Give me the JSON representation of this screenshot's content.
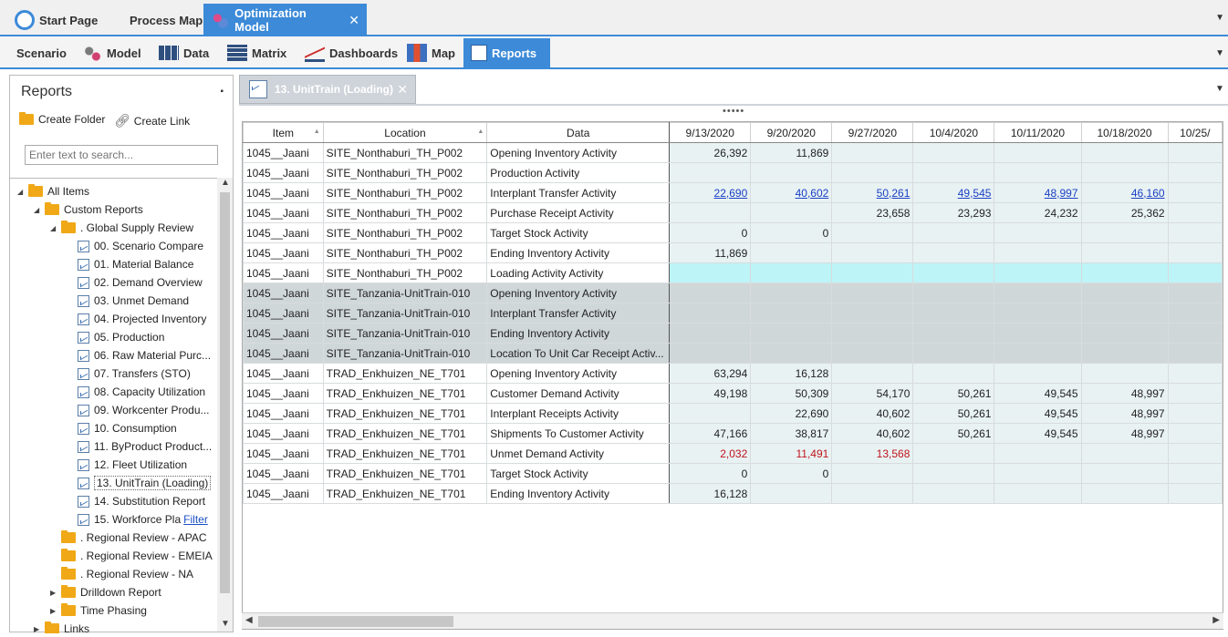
{
  "top_tabs": [
    {
      "label": "Start Page",
      "icon": "start-page-icon"
    },
    {
      "label": "Process Map",
      "icon": "none"
    },
    {
      "label": "Optimization Model",
      "icon": "optimization-model-icon",
      "active": true
    }
  ],
  "ribbon_tabs": [
    {
      "label": "Scenario",
      "icon": "none"
    },
    {
      "label": "Model",
      "icon": "gears-icon"
    },
    {
      "label": "Data",
      "icon": "table-icon"
    },
    {
      "label": "Matrix",
      "icon": "matrix-icon"
    },
    {
      "label": "Dashboards",
      "icon": "dashboard-chart-icon"
    },
    {
      "label": "Map",
      "icon": "map-icon"
    },
    {
      "label": "Reports",
      "icon": "report-icon",
      "active": true
    }
  ],
  "left_panel": {
    "title": "Reports",
    "create_folder": "Create Folder",
    "create_link": "Create Link",
    "search_placeholder": "Enter text to search..."
  },
  "tree": [
    {
      "label": "All Items",
      "type": "folder",
      "level": 0,
      "expanded": true
    },
    {
      "label": "Custom Reports",
      "type": "folder",
      "level": 1,
      "expanded": true
    },
    {
      "label": ". Global Supply Review",
      "type": "folder",
      "level": 2,
      "expanded": true
    },
    {
      "label": "00. Scenario Compare",
      "type": "report",
      "level": 3
    },
    {
      "label": "01. Material Balance",
      "type": "report",
      "level": 3
    },
    {
      "label": "02. Demand Overview",
      "type": "report",
      "level": 3
    },
    {
      "label": "03. Unmet Demand",
      "type": "report",
      "level": 3
    },
    {
      "label": "04. Projected Inventory",
      "type": "report",
      "level": 3
    },
    {
      "label": "05. Production",
      "type": "report",
      "level": 3
    },
    {
      "label": "06. Raw Material Purc...",
      "type": "report",
      "level": 3
    },
    {
      "label": "07. Transfers (STO)",
      "type": "report",
      "level": 3
    },
    {
      "label": "08. Capacity Utilization",
      "type": "report",
      "level": 3
    },
    {
      "label": "09. Workcenter Produ...",
      "type": "report",
      "level": 3
    },
    {
      "label": "10. Consumption",
      "type": "report",
      "level": 3
    },
    {
      "label": "11. ByProduct Product...",
      "type": "report",
      "level": 3
    },
    {
      "label": "12. Fleet Utilization",
      "type": "report",
      "level": 3
    },
    {
      "label": "13. UnitTrain (Loading)",
      "type": "report",
      "level": 3,
      "selected": true
    },
    {
      "label": "14. Substitution Report",
      "type": "report",
      "level": 3
    },
    {
      "label": "15. Workforce Pla",
      "type": "report",
      "level": 3,
      "filter": "Filter"
    },
    {
      "label": ". Regional Review - APAC",
      "type": "folder",
      "level": 2
    },
    {
      "label": ". Regional Review - EMEIA",
      "type": "folder",
      "level": 2
    },
    {
      "label": ". Regional Review - NA",
      "type": "folder",
      "level": 2
    },
    {
      "label": "Drilldown Report",
      "type": "folder",
      "level": 2,
      "collapsed": true
    },
    {
      "label": "Time Phasing",
      "type": "folder",
      "level": 2,
      "collapsed": true
    },
    {
      "label": "Links",
      "type": "folder",
      "level": 1,
      "collapsed": true
    }
  ],
  "doc_tab": {
    "label": "13. UnitTrain (Loading)"
  },
  "grid": {
    "headers": [
      "Item",
      "Location",
      "Data",
      "9/13/2020",
      "9/20/2020",
      "9/27/2020",
      "10/4/2020",
      "10/11/2020",
      "10/18/2020",
      "10/25/"
    ],
    "rows": [
      {
        "style": "std",
        "cells": [
          "1045__Jaani",
          "SITE_Nonthaburi_TH_P002",
          "Opening Inventory Activity",
          "26,392",
          "11,869",
          "",
          "",
          "",
          "",
          ""
        ]
      },
      {
        "style": "std",
        "cells": [
          "1045__Jaani",
          "SITE_Nonthaburi_TH_P002",
          "Production Activity",
          "",
          "",
          "",
          "",
          "",
          "",
          ""
        ]
      },
      {
        "style": "std",
        "link": true,
        "cells": [
          "1045__Jaani",
          "SITE_Nonthaburi_TH_P002",
          "Interplant Transfer Activity",
          "22,690",
          "40,602",
          "50,261",
          "49,545",
          "48,997",
          "46,160",
          ""
        ]
      },
      {
        "style": "std",
        "cells": [
          "1045__Jaani",
          "SITE_Nonthaburi_TH_P002",
          "Purchase Receipt Activity",
          "",
          "",
          "23,658",
          "23,293",
          "24,232",
          "25,362",
          ""
        ]
      },
      {
        "style": "std",
        "cells": [
          "1045__Jaani",
          "SITE_Nonthaburi_TH_P002",
          "Target Stock Activity",
          "0",
          "0",
          "",
          "",
          "",
          "",
          ""
        ]
      },
      {
        "style": "std",
        "cells": [
          "1045__Jaani",
          "SITE_Nonthaburi_TH_P002",
          "Ending Inventory Activity",
          "11,869",
          "",
          "",
          "",
          "",
          "",
          ""
        ]
      },
      {
        "style": "cyan",
        "cells": [
          "1045__Jaani",
          "SITE_Nonthaburi_TH_P002",
          "Loading Activity Activity",
          "",
          "",
          "",
          "",
          "",
          "",
          ""
        ]
      },
      {
        "style": "grey",
        "cells": [
          "1045__Jaani",
          "SITE_Tanzania-UnitTrain-010",
          "Opening Inventory Activity",
          "",
          "",
          "",
          "",
          "",
          "",
          ""
        ]
      },
      {
        "style": "grey",
        "cells": [
          "1045__Jaani",
          "SITE_Tanzania-UnitTrain-010",
          "Interplant Transfer Activity",
          "",
          "",
          "",
          "",
          "",
          "",
          ""
        ]
      },
      {
        "style": "grey",
        "cells": [
          "1045__Jaani",
          "SITE_Tanzania-UnitTrain-010",
          "Ending Inventory Activity",
          "",
          "",
          "",
          "",
          "",
          "",
          ""
        ]
      },
      {
        "style": "grey",
        "cells": [
          "1045__Jaani",
          "SITE_Tanzania-UnitTrain-010",
          "Location To Unit Car Receipt Activ...",
          "",
          "",
          "",
          "",
          "",
          "",
          ""
        ]
      },
      {
        "style": "std",
        "cells": [
          "1045__Jaani",
          "TRAD_Enkhuizen_NE_T701",
          "Opening Inventory Activity",
          "63,294",
          "16,128",
          "",
          "",
          "",
          "",
          ""
        ]
      },
      {
        "style": "std",
        "cells": [
          "1045__Jaani",
          "TRAD_Enkhuizen_NE_T701",
          "Customer Demand Activity",
          "49,198",
          "50,309",
          "54,170",
          "50,261",
          "49,545",
          "48,997",
          ""
        ]
      },
      {
        "style": "std",
        "cells": [
          "1045__Jaani",
          "TRAD_Enkhuizen_NE_T701",
          "Interplant Receipts Activity",
          "",
          "22,690",
          "40,602",
          "50,261",
          "49,545",
          "48,997",
          ""
        ]
      },
      {
        "style": "std",
        "cells": [
          "1045__Jaani",
          "TRAD_Enkhuizen_NE_T701",
          "Shipments To Customer Activity",
          "47,166",
          "38,817",
          "40,602",
          "50,261",
          "49,545",
          "48,997",
          ""
        ]
      },
      {
        "style": "std",
        "red": true,
        "cells": [
          "1045__Jaani",
          "TRAD_Enkhuizen_NE_T701",
          "Unmet Demand Activity",
          "2,032",
          "11,491",
          "13,568",
          "",
          "",
          "",
          ""
        ]
      },
      {
        "style": "std",
        "cells": [
          "1045__Jaani",
          "TRAD_Enkhuizen_NE_T701",
          "Target Stock Activity",
          "0",
          "0",
          "",
          "",
          "",
          "",
          ""
        ]
      },
      {
        "style": "std",
        "cells": [
          "1045__Jaani",
          "TRAD_Enkhuizen_NE_T701",
          "Ending Inventory Activity",
          "16,128",
          "",
          "",
          "",
          "",
          "",
          ""
        ]
      }
    ]
  },
  "colors": {
    "accent": "#3c8ad8",
    "folder": "#f0a817",
    "link": "#1a3fc4",
    "red": "#c0141c",
    "cyan_row": "#bdf4f7",
    "grey_row": "#d0d7d9",
    "std_row": "#e8f2f3"
  }
}
